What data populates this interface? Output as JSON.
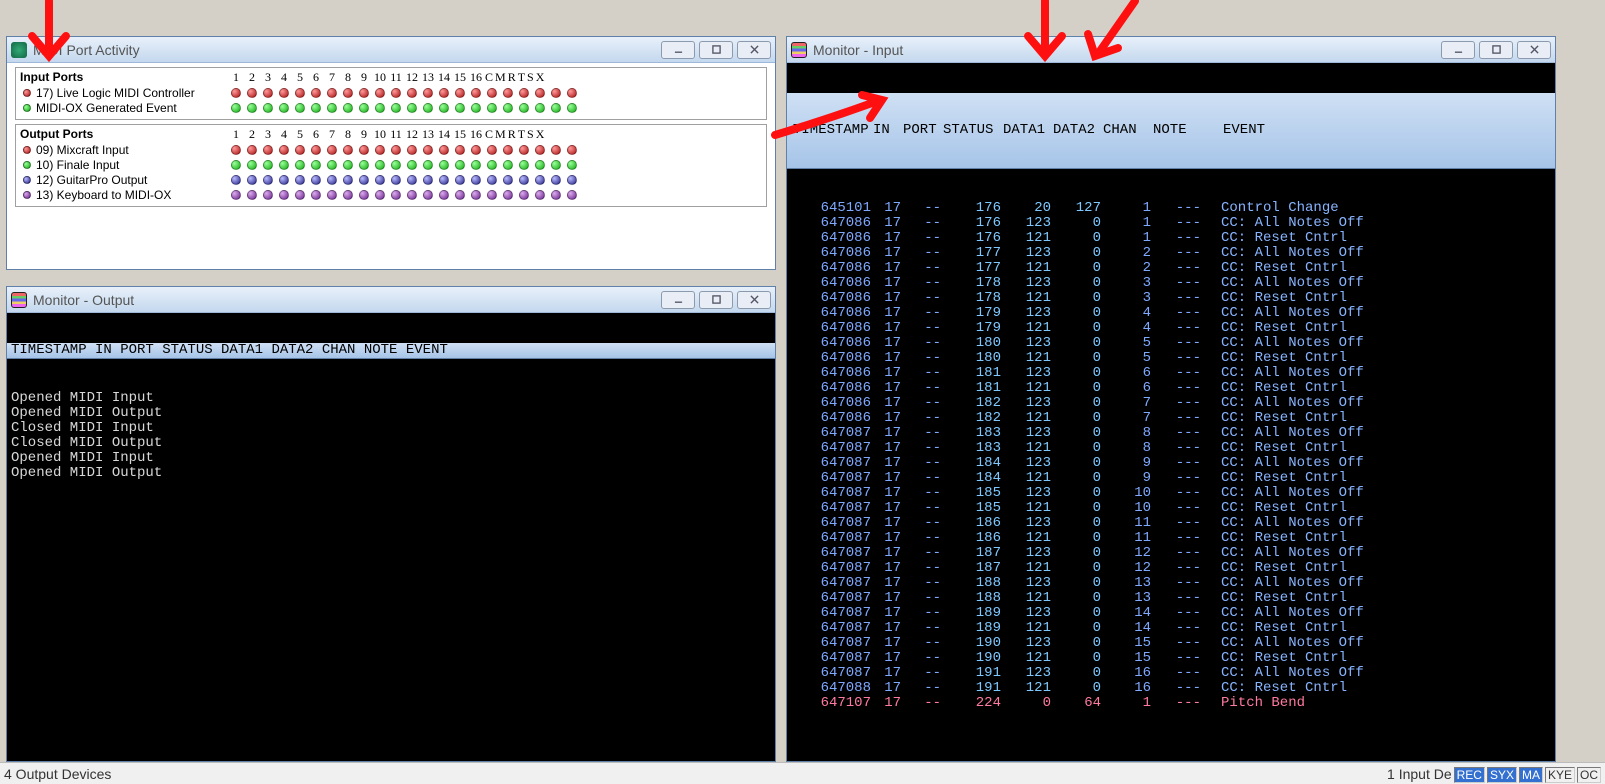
{
  "windows": {
    "port_activity": {
      "title": "MIDI Port Activity",
      "columns": [
        "1",
        "2",
        "3",
        "4",
        "5",
        "6",
        "7",
        "8",
        "9",
        "10",
        "11",
        "12",
        "13",
        "14",
        "15",
        "16",
        "C",
        "M",
        "R",
        "T",
        "S",
        "X"
      ],
      "input_heading": "Input Ports",
      "output_heading": "Output Ports",
      "input_ports": [
        {
          "led": "red",
          "label": "17) Live Logic MIDI Controller",
          "color": "red"
        },
        {
          "led": "green",
          "label": "MIDI-OX Generated Event",
          "color": "green"
        }
      ],
      "output_ports": [
        {
          "led": "red",
          "label": "09) Mixcraft Input",
          "color": "red"
        },
        {
          "led": "green",
          "label": "10) Finale Input",
          "color": "green"
        },
        {
          "led": "blue",
          "label": "12) GuitarPro Output",
          "color": "blue"
        },
        {
          "led": "purple",
          "label": "13) Keyboard to MIDI-OX",
          "color": "purple"
        }
      ]
    },
    "monitor_output": {
      "title": "Monitor - Output",
      "header": "TIMESTAMP IN PORT STATUS DATA1 DATA2 CHAN NOTE EVENT",
      "lines": [
        "Opened MIDI Input",
        "Opened MIDI Output",
        "Closed MIDI Input",
        "Closed MIDI Output",
        "Opened MIDI Input",
        "Opened MIDI Output"
      ]
    },
    "monitor_input": {
      "title": "Monitor - Input",
      "header_cols": [
        "TIMESTAMP",
        "IN",
        "PORT",
        "STATUS",
        "DATA1",
        "DATA2",
        "CHAN",
        "NOTE",
        "EVENT"
      ],
      "rows": [
        {
          "ts": "645101",
          "in": "17",
          "port": "--",
          "st": "176",
          "d1": "20",
          "d2": "127",
          "ch": "1",
          "nt": "---",
          "ev": "Control Change"
        },
        {
          "ts": "647086",
          "in": "17",
          "port": "--",
          "st": "176",
          "d1": "123",
          "d2": "0",
          "ch": "1",
          "nt": "---",
          "ev": "CC: All Notes Off"
        },
        {
          "ts": "647086",
          "in": "17",
          "port": "--",
          "st": "176",
          "d1": "121",
          "d2": "0",
          "ch": "1",
          "nt": "---",
          "ev": "CC: Reset Cntrl"
        },
        {
          "ts": "647086",
          "in": "17",
          "port": "--",
          "st": "177",
          "d1": "123",
          "d2": "0",
          "ch": "2",
          "nt": "---",
          "ev": "CC: All Notes Off"
        },
        {
          "ts": "647086",
          "in": "17",
          "port": "--",
          "st": "177",
          "d1": "121",
          "d2": "0",
          "ch": "2",
          "nt": "---",
          "ev": "CC: Reset Cntrl"
        },
        {
          "ts": "647086",
          "in": "17",
          "port": "--",
          "st": "178",
          "d1": "123",
          "d2": "0",
          "ch": "3",
          "nt": "---",
          "ev": "CC: All Notes Off"
        },
        {
          "ts": "647086",
          "in": "17",
          "port": "--",
          "st": "178",
          "d1": "121",
          "d2": "0",
          "ch": "3",
          "nt": "---",
          "ev": "CC: Reset Cntrl"
        },
        {
          "ts": "647086",
          "in": "17",
          "port": "--",
          "st": "179",
          "d1": "123",
          "d2": "0",
          "ch": "4",
          "nt": "---",
          "ev": "CC: All Notes Off"
        },
        {
          "ts": "647086",
          "in": "17",
          "port": "--",
          "st": "179",
          "d1": "121",
          "d2": "0",
          "ch": "4",
          "nt": "---",
          "ev": "CC: Reset Cntrl"
        },
        {
          "ts": "647086",
          "in": "17",
          "port": "--",
          "st": "180",
          "d1": "123",
          "d2": "0",
          "ch": "5",
          "nt": "---",
          "ev": "CC: All Notes Off"
        },
        {
          "ts": "647086",
          "in": "17",
          "port": "--",
          "st": "180",
          "d1": "121",
          "d2": "0",
          "ch": "5",
          "nt": "---",
          "ev": "CC: Reset Cntrl"
        },
        {
          "ts": "647086",
          "in": "17",
          "port": "--",
          "st": "181",
          "d1": "123",
          "d2": "0",
          "ch": "6",
          "nt": "---",
          "ev": "CC: All Notes Off"
        },
        {
          "ts": "647086",
          "in": "17",
          "port": "--",
          "st": "181",
          "d1": "121",
          "d2": "0",
          "ch": "6",
          "nt": "---",
          "ev": "CC: Reset Cntrl"
        },
        {
          "ts": "647086",
          "in": "17",
          "port": "--",
          "st": "182",
          "d1": "123",
          "d2": "0",
          "ch": "7",
          "nt": "---",
          "ev": "CC: All Notes Off"
        },
        {
          "ts": "647086",
          "in": "17",
          "port": "--",
          "st": "182",
          "d1": "121",
          "d2": "0",
          "ch": "7",
          "nt": "---",
          "ev": "CC: Reset Cntrl"
        },
        {
          "ts": "647087",
          "in": "17",
          "port": "--",
          "st": "183",
          "d1": "123",
          "d2": "0",
          "ch": "8",
          "nt": "---",
          "ev": "CC: All Notes Off"
        },
        {
          "ts": "647087",
          "in": "17",
          "port": "--",
          "st": "183",
          "d1": "121",
          "d2": "0",
          "ch": "8",
          "nt": "---",
          "ev": "CC: Reset Cntrl"
        },
        {
          "ts": "647087",
          "in": "17",
          "port": "--",
          "st": "184",
          "d1": "123",
          "d2": "0",
          "ch": "9",
          "nt": "---",
          "ev": "CC: All Notes Off"
        },
        {
          "ts": "647087",
          "in": "17",
          "port": "--",
          "st": "184",
          "d1": "121",
          "d2": "0",
          "ch": "9",
          "nt": "---",
          "ev": "CC: Reset Cntrl"
        },
        {
          "ts": "647087",
          "in": "17",
          "port": "--",
          "st": "185",
          "d1": "123",
          "d2": "0",
          "ch": "10",
          "nt": "---",
          "ev": "CC: All Notes Off"
        },
        {
          "ts": "647087",
          "in": "17",
          "port": "--",
          "st": "185",
          "d1": "121",
          "d2": "0",
          "ch": "10",
          "nt": "---",
          "ev": "CC: Reset Cntrl"
        },
        {
          "ts": "647087",
          "in": "17",
          "port": "--",
          "st": "186",
          "d1": "123",
          "d2": "0",
          "ch": "11",
          "nt": "---",
          "ev": "CC: All Notes Off"
        },
        {
          "ts": "647087",
          "in": "17",
          "port": "--",
          "st": "186",
          "d1": "121",
          "d2": "0",
          "ch": "11",
          "nt": "---",
          "ev": "CC: Reset Cntrl"
        },
        {
          "ts": "647087",
          "in": "17",
          "port": "--",
          "st": "187",
          "d1": "123",
          "d2": "0",
          "ch": "12",
          "nt": "---",
          "ev": "CC: All Notes Off"
        },
        {
          "ts": "647087",
          "in": "17",
          "port": "--",
          "st": "187",
          "d1": "121",
          "d2": "0",
          "ch": "12",
          "nt": "---",
          "ev": "CC: Reset Cntrl"
        },
        {
          "ts": "647087",
          "in": "17",
          "port": "--",
          "st": "188",
          "d1": "123",
          "d2": "0",
          "ch": "13",
          "nt": "---",
          "ev": "CC: All Notes Off"
        },
        {
          "ts": "647087",
          "in": "17",
          "port": "--",
          "st": "188",
          "d1": "121",
          "d2": "0",
          "ch": "13",
          "nt": "---",
          "ev": "CC: Reset Cntrl"
        },
        {
          "ts": "647087",
          "in": "17",
          "port": "--",
          "st": "189",
          "d1": "123",
          "d2": "0",
          "ch": "14",
          "nt": "---",
          "ev": "CC: All Notes Off"
        },
        {
          "ts": "647087",
          "in": "17",
          "port": "--",
          "st": "189",
          "d1": "121",
          "d2": "0",
          "ch": "14",
          "nt": "---",
          "ev": "CC: Reset Cntrl"
        },
        {
          "ts": "647087",
          "in": "17",
          "port": "--",
          "st": "190",
          "d1": "123",
          "d2": "0",
          "ch": "15",
          "nt": "---",
          "ev": "CC: All Notes Off"
        },
        {
          "ts": "647087",
          "in": "17",
          "port": "--",
          "st": "190",
          "d1": "121",
          "d2": "0",
          "ch": "15",
          "nt": "---",
          "ev": "CC: Reset Cntrl"
        },
        {
          "ts": "647087",
          "in": "17",
          "port": "--",
          "st": "191",
          "d1": "123",
          "d2": "0",
          "ch": "16",
          "nt": "---",
          "ev": "CC: All Notes Off"
        },
        {
          "ts": "647088",
          "in": "17",
          "port": "--",
          "st": "191",
          "d1": "121",
          "d2": "0",
          "ch": "16",
          "nt": "---",
          "ev": "CC: Reset Cntrl"
        },
        {
          "ts": "647107",
          "in": "17",
          "port": "--",
          "st": "224",
          "d1": "0",
          "d2": "64",
          "ch": "1",
          "nt": "---",
          "ev": "Pitch Bend",
          "pink": true
        }
      ]
    }
  },
  "statusbar": {
    "left": "4 Output Devices",
    "right_prefix": "1 Input De",
    "segs": [
      "REC",
      "SYX",
      "MA",
      "KYE",
      "OC"
    ]
  }
}
